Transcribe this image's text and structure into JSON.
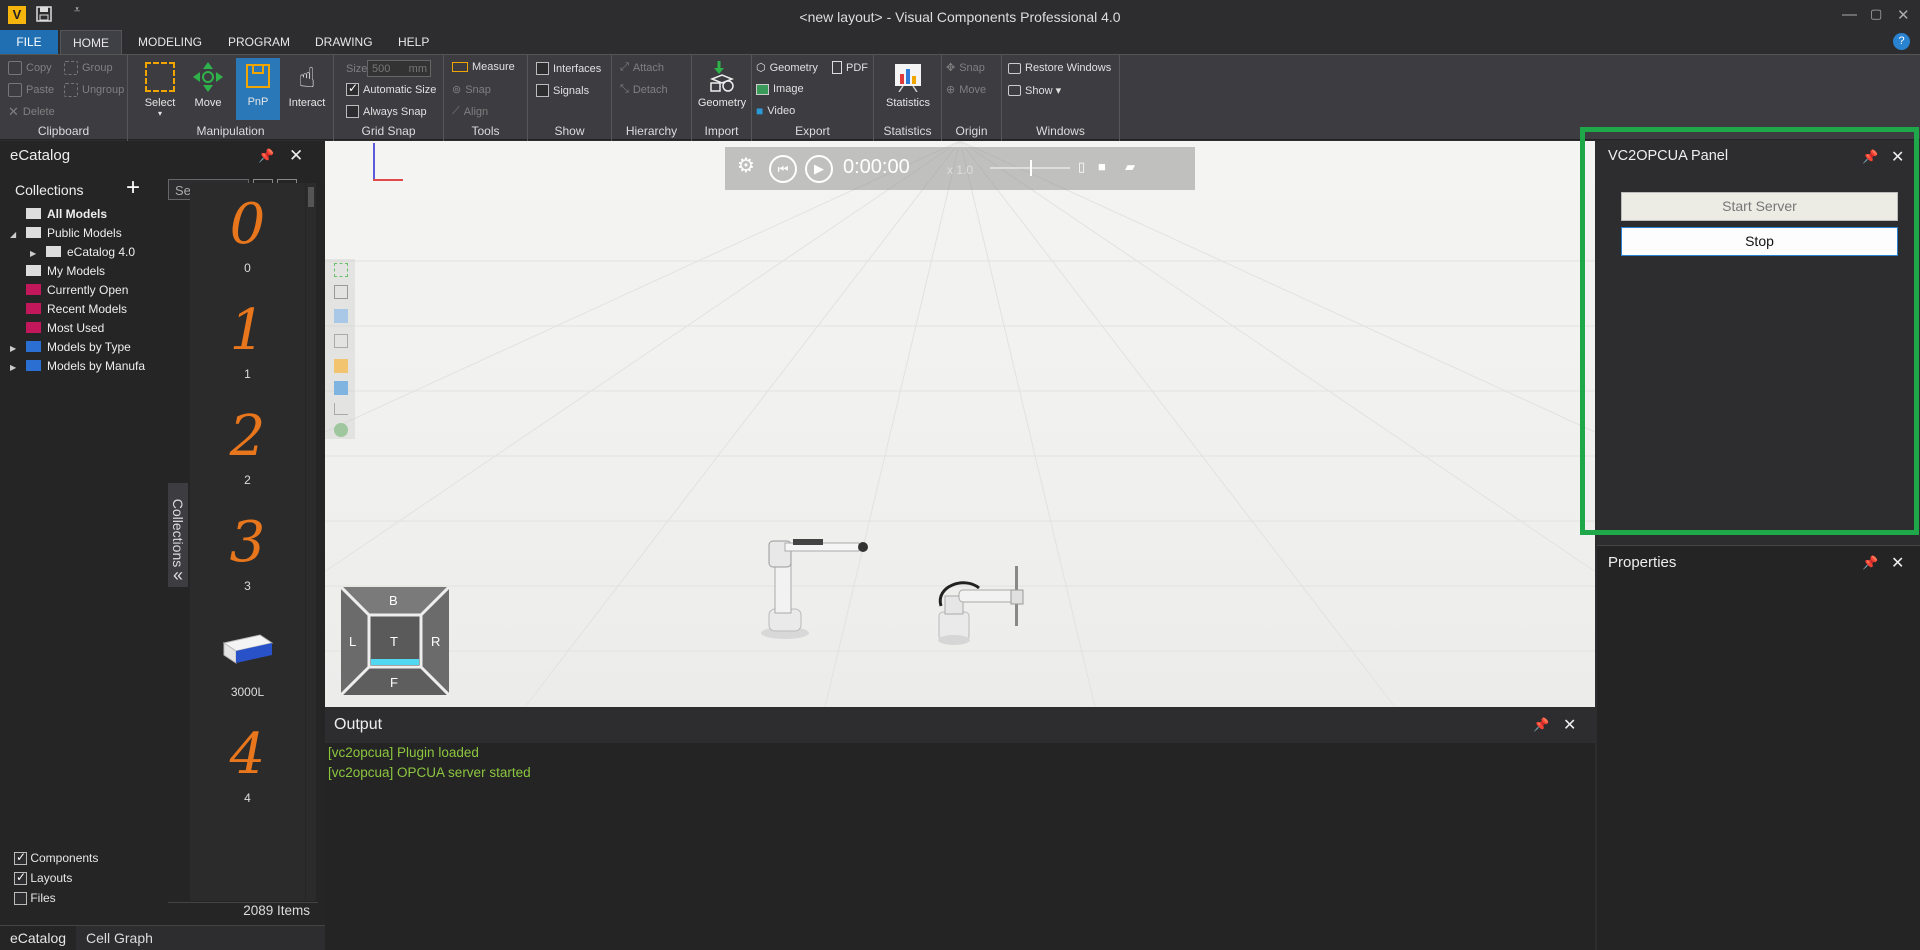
{
  "titlebar": {
    "title": "<new layout> - Visual Components Professional 4.0",
    "logo": "V",
    "save_icon": "save-icon",
    "quick_access_icon": "chevron-down-icon"
  },
  "menu": {
    "tabs": [
      "FILE",
      "HOME",
      "MODELING",
      "PROGRAM",
      "DRAWING",
      "HELP"
    ],
    "active": "HOME",
    "help_icon": "?"
  },
  "ribbon": {
    "clipboard": {
      "label": "Clipboard",
      "copy": "Copy",
      "paste": "Paste",
      "delete": "Delete",
      "group": "Group",
      "ungroup": "Ungroup"
    },
    "manipulation": {
      "label": "Manipulation",
      "select": "Select",
      "move": "Move",
      "pnp": "PnP",
      "interact": "Interact"
    },
    "grid_snap": {
      "label": "Grid Snap",
      "size_label": "Size",
      "size_value": "500",
      "size_unit": "mm",
      "automatic_size": "Automatic Size",
      "always_snap": "Always Snap"
    },
    "tools": {
      "label": "Tools",
      "measure": "Measure",
      "snap": "Snap",
      "align": "Align"
    },
    "show": {
      "label": "Show",
      "interfaces": "Interfaces",
      "signals": "Signals"
    },
    "hierarchy": {
      "label": "Hierarchy",
      "attach": "Attach",
      "detach": "Detach"
    },
    "import": {
      "label": "Import",
      "geometry": "Geometry"
    },
    "export": {
      "label": "Export",
      "geometry": "Geometry",
      "pdf": "PDF",
      "image": "Image",
      "video": "Video"
    },
    "statistics": {
      "label": "Statistics",
      "statistics": "Statistics"
    },
    "origin": {
      "label": "Origin",
      "snap": "Snap",
      "move": "Move"
    },
    "windows": {
      "label": "Windows",
      "restore": "Restore Windows",
      "show": "Show ▾"
    }
  },
  "ecatalog": {
    "title": "eCatalog",
    "collections_label": "Collections",
    "search_placeholder": "Search",
    "tree": [
      {
        "label": "All Models",
        "bold": true,
        "indent": 0,
        "arrow": ""
      },
      {
        "label": "Public Models",
        "indent": 0,
        "arrow": "◢"
      },
      {
        "label": "eCatalog 4.0",
        "indent": 1,
        "arrow": "▶"
      },
      {
        "label": "My Models",
        "indent": 0,
        "arrow": ""
      },
      {
        "label": "Currently Open",
        "indent": 0,
        "arrow": ""
      },
      {
        "label": "Recent Models",
        "indent": 0,
        "arrow": ""
      },
      {
        "label": "Most Used",
        "indent": 0,
        "arrow": ""
      },
      {
        "label": "Models by Type",
        "indent": 0,
        "arrow": "▶"
      },
      {
        "label": "Models by Manufa",
        "indent": 0,
        "arrow": "▶"
      }
    ],
    "models": [
      {
        "glyph": "0",
        "label": "0"
      },
      {
        "glyph": "1",
        "label": "1"
      },
      {
        "glyph": "2",
        "label": "2"
      },
      {
        "glyph": "3",
        "label": "3"
      },
      {
        "glyph": "",
        "label": "3000L"
      },
      {
        "glyph": "4",
        "label": "4"
      }
    ],
    "side_tab": "Collections",
    "filters": [
      {
        "label": "Components",
        "checked": true
      },
      {
        "label": "Layouts",
        "checked": true
      },
      {
        "label": "Files",
        "checked": false
      }
    ],
    "item_count": "2089 Items",
    "bottom_tabs": [
      "eCatalog",
      "Cell Graph"
    ]
  },
  "viewport": {
    "time": "0:00:00",
    "speed": "x 1.0",
    "navcube": {
      "top": "B",
      "left": "L",
      "center": "T",
      "right": "R",
      "bottom": "F"
    }
  },
  "output": {
    "title": "Output",
    "lines": [
      "[vc2opcua] Plugin loaded",
      "[vc2opcua] OPCUA server started"
    ]
  },
  "vc2opcua": {
    "title": "VC2OPCUA Panel",
    "start": "Start Server",
    "stop": "Stop"
  },
  "properties": {
    "title": "Properties"
  },
  "colors": {
    "accent": "#1f6fb2",
    "highlight_box": "#1fa84a",
    "log_text": "#8cc63f",
    "model_glyph": "#e8761c"
  }
}
